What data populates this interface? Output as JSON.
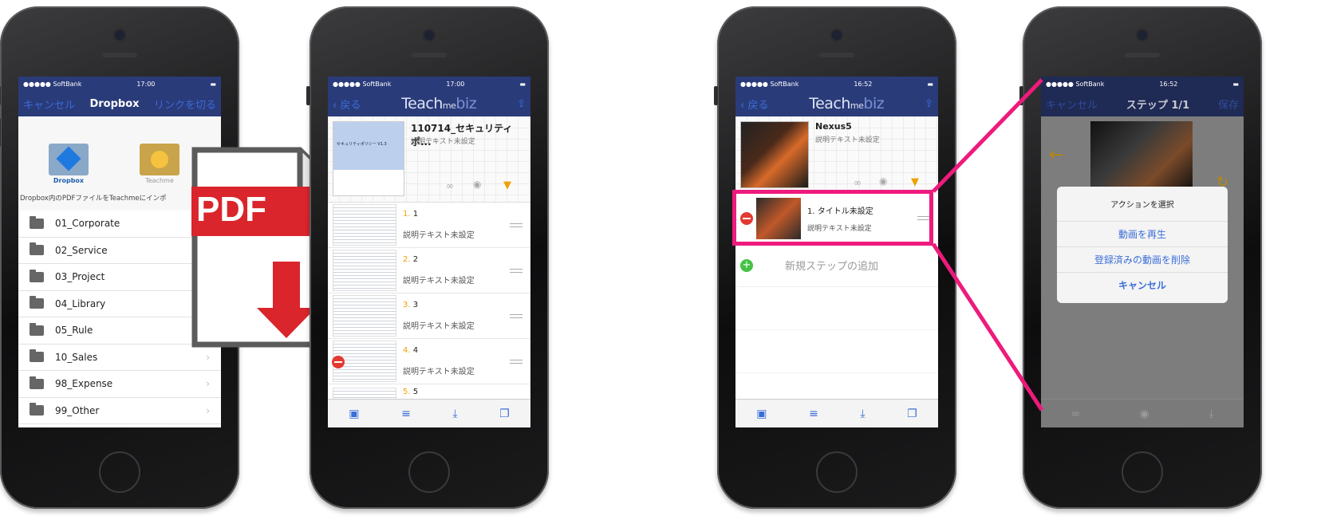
{
  "phone1": {
    "status": {
      "carrier": "●●●●● SoftBank",
      "time": "17:00"
    },
    "nav": {
      "cancel": "キャンセル",
      "title": "Dropbox",
      "unlink": "リンクを切る"
    },
    "dropbox_label": "Dropbox",
    "teachme_label": "Teachme",
    "description": "Dropbox内のPDFファイルをTeachmeにインポ",
    "folders": [
      "01_Corporate",
      "02_Service",
      "03_Project",
      "04_Library",
      "05_Rule",
      "10_Sales",
      "98_Expense",
      "99_Other"
    ]
  },
  "pdf_overlay": {
    "label": "PDF"
  },
  "phone2": {
    "status": {
      "carrier": "●●●●● SoftBank",
      "time": "17:00"
    },
    "nav": {
      "back": "戻る",
      "logo_a": "Teach",
      "logo_b": "me",
      "logo_c": "biz"
    },
    "doc_title": "110714_セキュリティポ...",
    "doc_desc": "説明テキスト未設定",
    "cover_text": "セキュリティポリシー V1.3",
    "steps": [
      {
        "num": "1.",
        "title": "1",
        "desc": "説明テキスト未設定"
      },
      {
        "num": "2.",
        "title": "2",
        "desc": "説明テキスト未設定"
      },
      {
        "num": "3.",
        "title": "3",
        "desc": "説明テキスト未設定"
      },
      {
        "num": "4.",
        "title": "4",
        "desc": "説明テキスト未設定"
      },
      {
        "num": "5.",
        "title": "5",
        "desc": ""
      }
    ]
  },
  "phone3": {
    "status": {
      "carrier": "●●●●● SoftBank",
      "time": "16:52"
    },
    "nav": {
      "back": "戻る",
      "logo_a": "Teach",
      "logo_b": "me",
      "logo_c": "biz"
    },
    "doc_title": "Nexus5",
    "doc_desc": "説明テキスト未設定",
    "step": {
      "title": "1. タイトル未設定",
      "desc": "説明テキスト未設定"
    },
    "add_step": "新規ステップの追加"
  },
  "phone4": {
    "status": {
      "carrier": "●●●●● SoftBank",
      "time": "16:52"
    },
    "nav": {
      "cancel": "キャンセル",
      "title": "ステップ 1/1",
      "save": "保存"
    },
    "dialog": {
      "title": "アクションを選択",
      "play": "動画を再生",
      "delete": "登録済みの動画を削除",
      "cancel": "キャンセル"
    }
  },
  "colors": {
    "accent": "#3b6ed8",
    "navbar": "#2a3b7a",
    "highlight": "#ee1a7c",
    "pdf_red": "#d9252b"
  }
}
